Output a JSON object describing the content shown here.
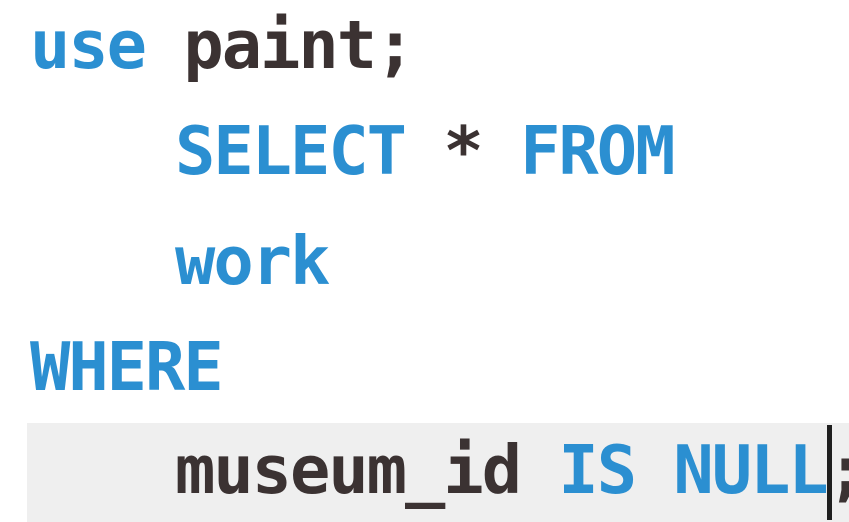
{
  "editor": {
    "lines": [
      {
        "tokens": [
          "use",
          " ",
          "paint",
          ";"
        ]
      },
      {
        "tokens": [
          "SELECT",
          " ",
          "*",
          " ",
          "FROM"
        ]
      },
      {
        "tokens": [
          "work"
        ]
      },
      {
        "tokens": [
          "WHERE"
        ]
      },
      {
        "tokens": [
          "museum_id",
          " ",
          "IS",
          " ",
          "NULL",
          ";"
        ]
      }
    ]
  },
  "colors": {
    "keyword": "#2b8fd1",
    "identifier": "#3b3232",
    "current_line_bg": "#efefef",
    "cursor": "#1f1f1f"
  }
}
